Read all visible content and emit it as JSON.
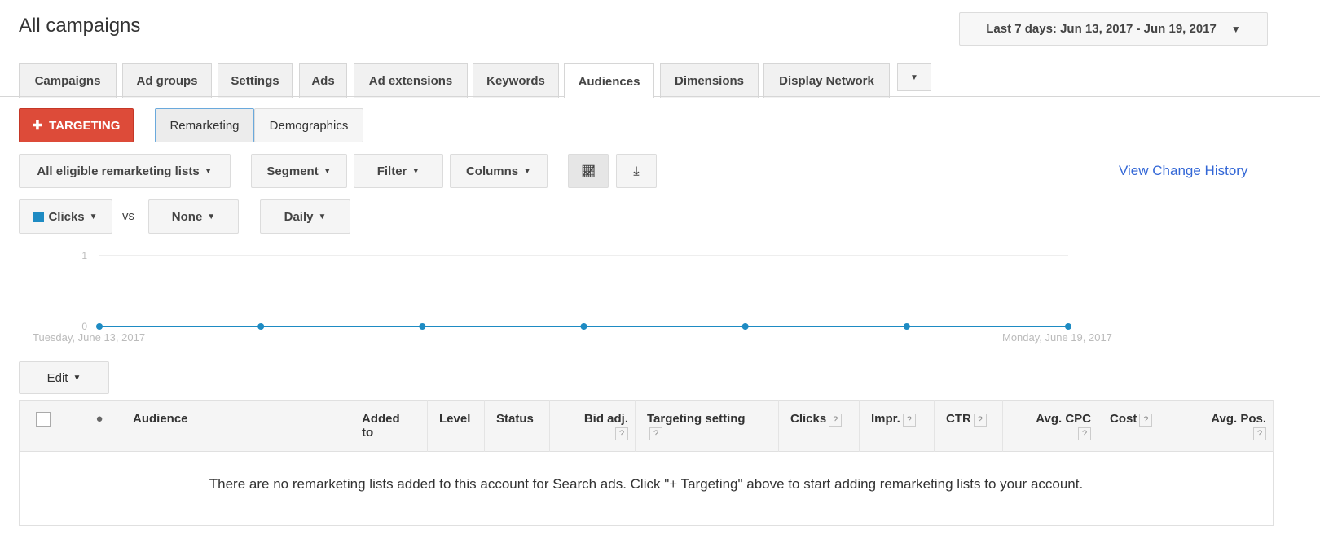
{
  "header": {
    "title": "All campaigns",
    "date_range": "Last 7 days: Jun 13, 2017 - Jun 19, 2017"
  },
  "tabs": [
    "Campaigns",
    "Ad groups",
    "Settings",
    "Ads",
    "Ad extensions",
    "Keywords",
    "Audiences",
    "Dimensions",
    "Display Network"
  ],
  "active_tab": "Audiences",
  "toolbar": {
    "targeting": "TARGETING",
    "remarketing": "Remarketing",
    "demographics": "Demographics",
    "lists": "All eligible remarketing lists",
    "segment": "Segment",
    "filter": "Filter",
    "columns": "Columns",
    "view_history": "View Change History",
    "metric1": "Clicks",
    "vs": "vs",
    "metric2": "None",
    "period": "Daily",
    "edit": "Edit"
  },
  "colors": {
    "accent": "#dd4b39",
    "series": "#1e8bc3",
    "link": "#3367d6"
  },
  "chart_data": {
    "type": "line",
    "x": [
      "Jun 13, 2017",
      "Jun 14, 2017",
      "Jun 15, 2017",
      "Jun 16, 2017",
      "Jun 17, 2017",
      "Jun 18, 2017",
      "Jun 19, 2017"
    ],
    "series": [
      {
        "name": "Clicks",
        "values": [
          0,
          0,
          0,
          0,
          0,
          0,
          0
        ]
      }
    ],
    "ylim": [
      0,
      1
    ],
    "yticks": [
      "0",
      "1"
    ],
    "x_start_label": "Tuesday, June 13, 2017",
    "x_end_label": "Monday, June 19, 2017",
    "grid": true
  },
  "table": {
    "columns": [
      {
        "label": "Audience",
        "help": false
      },
      {
        "label": "Added to",
        "help": false
      },
      {
        "label": "Level",
        "help": false
      },
      {
        "label": "Status",
        "help": false
      },
      {
        "label": "Bid adj.",
        "help": true
      },
      {
        "label": "Targeting setting",
        "help": true
      },
      {
        "label": "Clicks",
        "help": true
      },
      {
        "label": "Impr.",
        "help": true
      },
      {
        "label": "CTR",
        "help": true
      },
      {
        "label": "Avg. CPC",
        "help": true
      },
      {
        "label": "Cost",
        "help": true
      },
      {
        "label": "Avg. Pos.",
        "help": true
      }
    ],
    "empty_message": "There are no remarketing lists added to this account for Search ads. Click \"+ Targeting\" above to start adding remarketing lists to your account."
  }
}
